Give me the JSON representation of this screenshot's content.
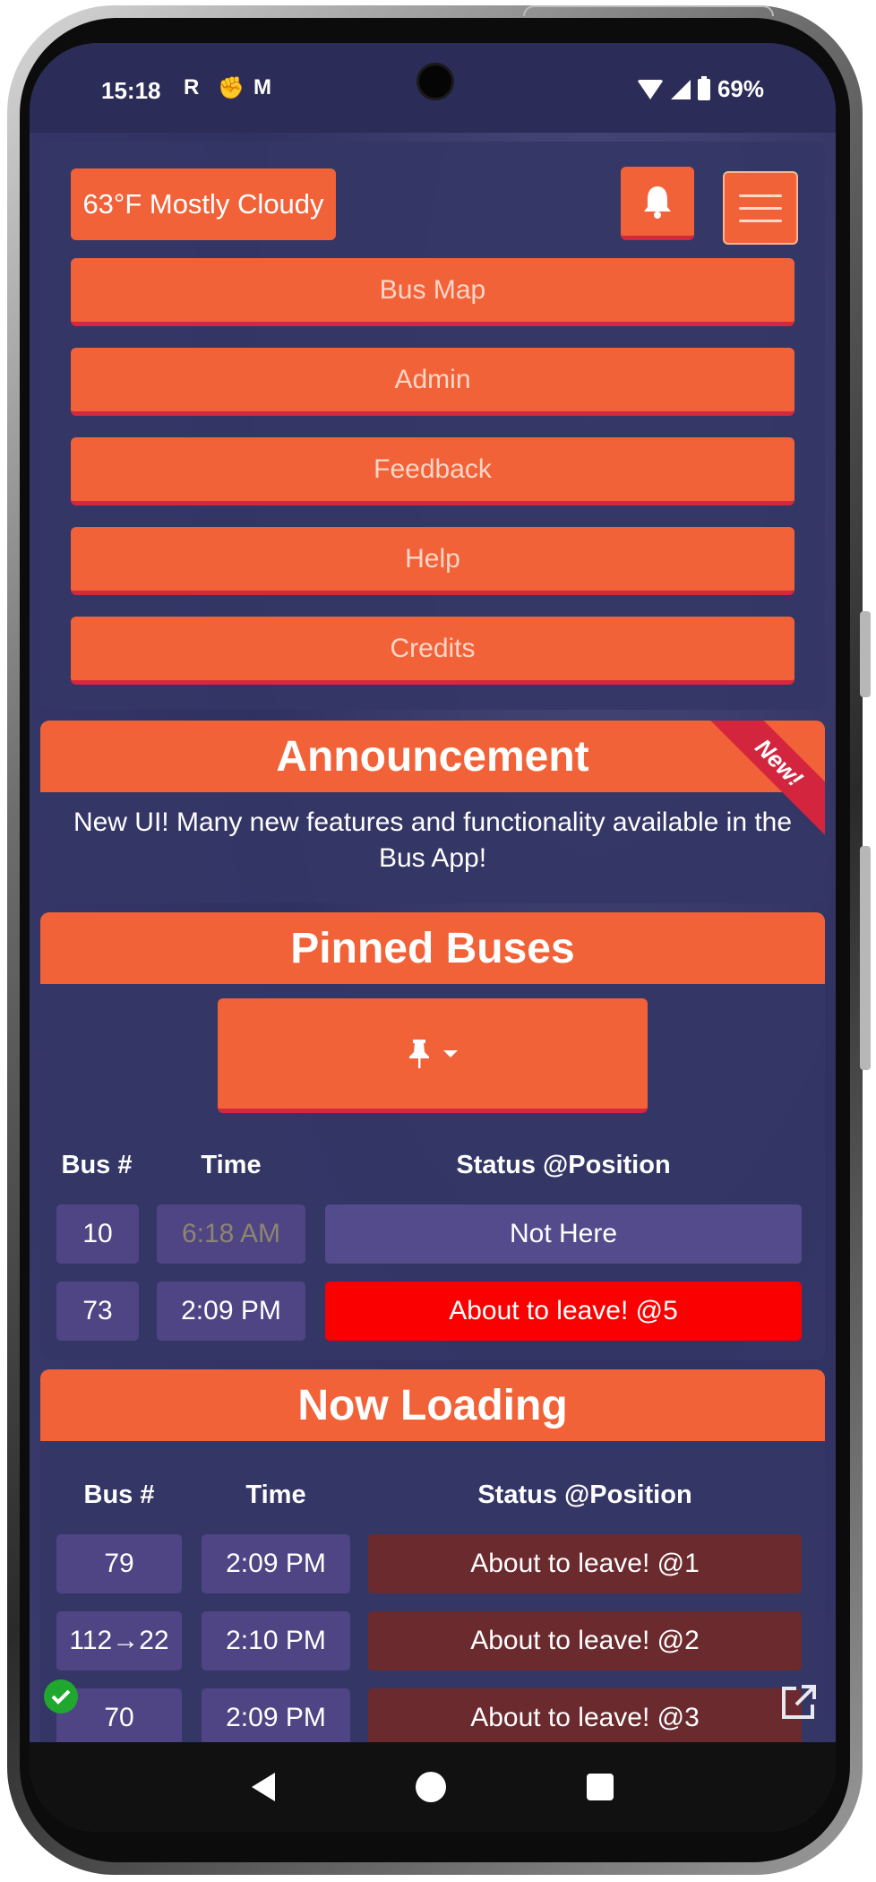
{
  "statusbar": {
    "time": "15:18",
    "app_icons": [
      "R",
      "✊",
      "M"
    ],
    "battery": "69%"
  },
  "header": {
    "weather": "63°F Mostly Cloudy"
  },
  "menu": {
    "items": [
      {
        "label": "Bus Map"
      },
      {
        "label": "Admin"
      },
      {
        "label": "Feedback"
      },
      {
        "label": "Help"
      },
      {
        "label": "Credits"
      }
    ]
  },
  "announcement": {
    "title": "Announcement",
    "badge": "New!",
    "text": "New UI! Many new features and functionality available in the Bus App!"
  },
  "pinned": {
    "title": "Pinned Buses",
    "columns": [
      "Bus #",
      "Time",
      "Status @Position"
    ],
    "rows": [
      {
        "bus": "10",
        "time": "6:18 AM",
        "status": "Not Here"
      },
      {
        "bus": "73",
        "time": "2:09 PM",
        "status": "About to leave! @5"
      }
    ]
  },
  "loading": {
    "title": "Now Loading",
    "columns": [
      "Bus #",
      "Time",
      "Status @Position"
    ],
    "rows": [
      {
        "bus": "79",
        "time": "2:09 PM",
        "status": "About to leave! @1"
      },
      {
        "bus": "112→22",
        "time": "2:10 PM",
        "status": "About to leave! @2"
      },
      {
        "bus": "70",
        "time": "2:09 PM",
        "status": "About to leave! @3"
      }
    ]
  },
  "colors": {
    "accent": "#f26238",
    "accent_border": "#d3283e",
    "leaving_pinned": "#fa0000",
    "leaving_loading": "#6b2a2e",
    "cell": "#4f4585"
  }
}
